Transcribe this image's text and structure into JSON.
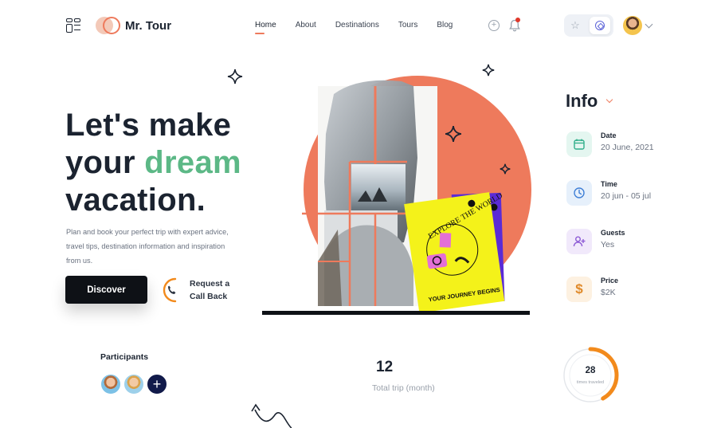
{
  "header": {
    "brand": "Mr. Tour",
    "nav": [
      {
        "label": "Home",
        "active": true
      },
      {
        "label": "About",
        "active": false
      },
      {
        "label": "Destinations",
        "active": false
      },
      {
        "label": "Tours",
        "active": false
      },
      {
        "label": "Blog",
        "active": false
      }
    ],
    "icons": [
      "menu-grid-icon",
      "plus-circle-icon",
      "bell-icon",
      "star-icon",
      "coin-icon",
      "chevron-down-icon"
    ],
    "notification_dot_color": "#e0382a"
  },
  "hero": {
    "title_line1": "Let's make",
    "title_line2_a": "your ",
    "title_line2_b": "dream",
    "title_line3": "vacation.",
    "description": "Plan and book your perfect trip with expert advice, travel tips, destination information and inspiration from us.",
    "discover_label": "Discover",
    "callback_line1": "Request a",
    "callback_line2": "Call Back",
    "accent_color": "#5cb886"
  },
  "collage": {
    "book_title": "EXPLORE THE WORLD",
    "book_subtitle": "YOUR JOURNEY BEGINS",
    "circle_color": "#ee7a5c",
    "book_color": "#f4f21a",
    "book_back_color": "#5a2bd6"
  },
  "participants": {
    "label": "Participants",
    "add_symbol": "+"
  },
  "stats": {
    "trips_value": "12",
    "trips_label": "Total trip (month)",
    "gauge_value": "28",
    "gauge_label": "times traveled",
    "gauge_fill_fraction": 0.42,
    "gauge_color": "#f28a1c"
  },
  "info": {
    "title": "Info",
    "items": [
      {
        "key": "Date",
        "value": "20 June, 2021",
        "icon": "calendar-icon",
        "color": "#2fae8a",
        "bg": "#e4f6f0"
      },
      {
        "key": "Time",
        "value": "20 jun - 05 jul",
        "icon": "clock-icon",
        "color": "#3f7fd6",
        "bg": "#e6f0fb"
      },
      {
        "key": "Guests",
        "value": "Yes",
        "icon": "add-user-icon",
        "color": "#8e5cd6",
        "bg": "#f1e9fb"
      },
      {
        "key": "Price",
        "value": "$2K",
        "icon": "dollar-icon",
        "color": "#e08a2a",
        "bg": "#fdf1e1"
      }
    ]
  }
}
